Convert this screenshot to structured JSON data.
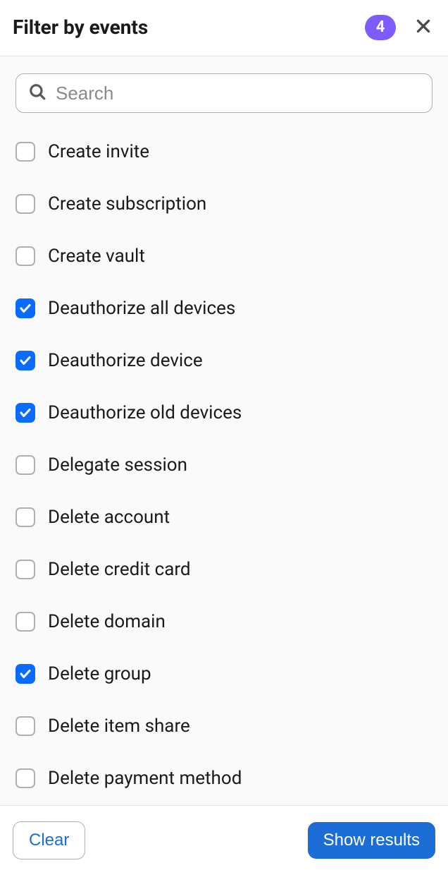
{
  "header": {
    "title": "Filter by events",
    "badge_count": "4"
  },
  "search": {
    "placeholder": "Search",
    "value": ""
  },
  "events": [
    {
      "label": "Create invite",
      "checked": false
    },
    {
      "label": "Create subscription",
      "checked": false
    },
    {
      "label": "Create vault",
      "checked": false
    },
    {
      "label": "Deauthorize all devices",
      "checked": true
    },
    {
      "label": "Deauthorize device",
      "checked": true
    },
    {
      "label": "Deauthorize old devices",
      "checked": true
    },
    {
      "label": "Delegate session",
      "checked": false
    },
    {
      "label": "Delete account",
      "checked": false
    },
    {
      "label": "Delete credit card",
      "checked": false
    },
    {
      "label": "Delete domain",
      "checked": false
    },
    {
      "label": "Delete group",
      "checked": true
    },
    {
      "label": "Delete item share",
      "checked": false
    },
    {
      "label": "Delete payment method",
      "checked": false
    }
  ],
  "footer": {
    "clear_label": "Clear",
    "show_results_label": "Show results"
  }
}
